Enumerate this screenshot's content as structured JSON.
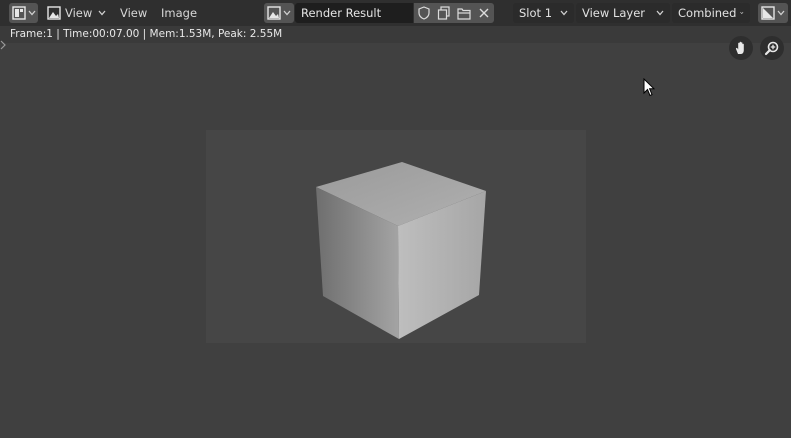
{
  "header": {
    "editor_type_icon": "image-editor-icon",
    "view_mode_icon": "image-view-icon",
    "view_dropdown_label": "View",
    "menus": [
      "View",
      "Image"
    ],
    "image_browse_icon": "image-browse-icon",
    "image_name": "Render Result",
    "fake_user_icon": "shield-icon",
    "new_image_icon": "duplicate-icon",
    "open_image_icon": "folder-icon",
    "unlink_icon": "close-icon",
    "slot_label": "Slot 1",
    "view_layer_label": "View Layer",
    "pass_label": "Combined",
    "display_channels_icon": "display-channels-icon"
  },
  "status": {
    "text": "Frame:1 | Time:00:07.00 | Mem:1.53M, Peak: 2.55M"
  },
  "viewport": {
    "navigation": [
      "hand-pan-icon",
      "zoom-icon"
    ],
    "render": "gray cube on dark gray background"
  },
  "colors": {
    "header_bg": "#2f2f2f",
    "canvas_bg": "#404040",
    "render_bg": "#464646",
    "button_bg": "#545454",
    "field_bg": "#1e1e1e"
  }
}
